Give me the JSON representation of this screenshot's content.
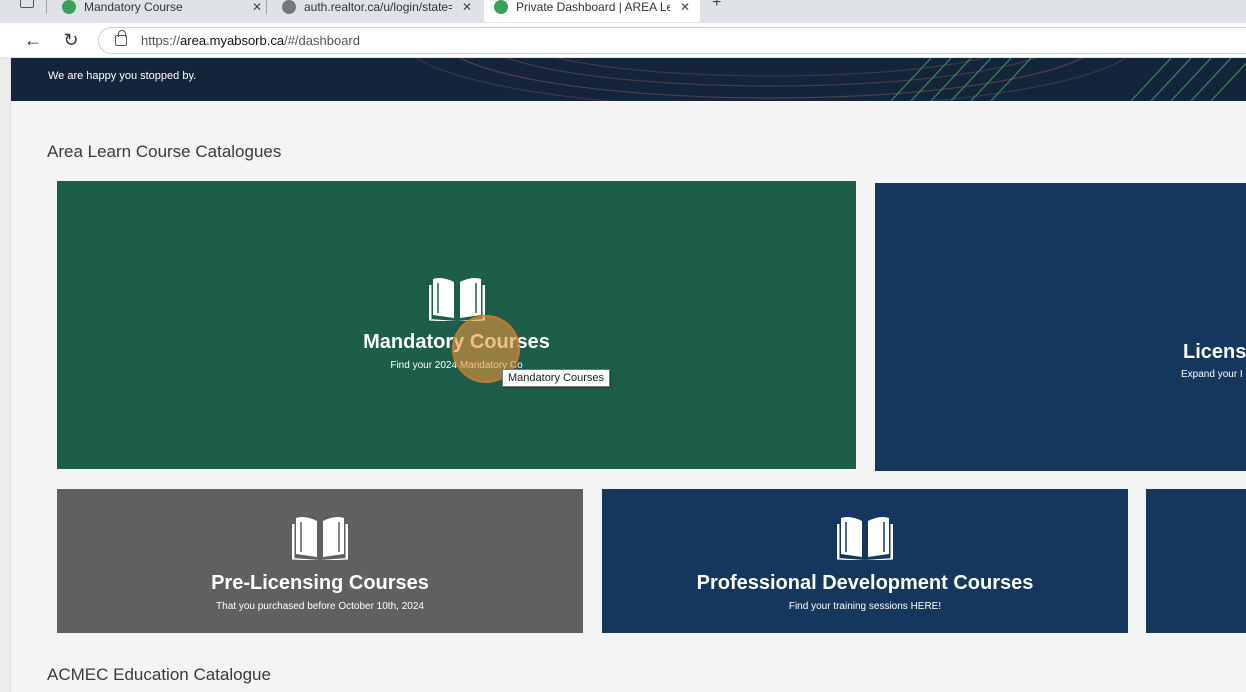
{
  "browser": {
    "tabs": [
      {
        "title": "Mandatory Course",
        "favicon_color": "#3aa05a"
      },
      {
        "title": "auth.realtor.ca/u/login/state=hKFo",
        "favicon_color": "#777777"
      },
      {
        "title": "Private Dashboard | AREA Learn",
        "favicon_color": "#3aa05a"
      }
    ],
    "close_glyph": "✕",
    "new_tab_glyph": "+",
    "back_glyph": "←",
    "reload_glyph": "↻",
    "url": {
      "scheme": "https://",
      "host": "area.myabsorb.ca",
      "path": "/#/dashboard"
    }
  },
  "hero": {
    "subtitle": "We are happy you stopped by."
  },
  "catalogue": {
    "title": "Area Learn Course Catalogues",
    "tiles": [
      {
        "title": "Mandatory Courses",
        "subtitle": "Find your 2024 Mandatory Co",
        "color": "#1c5e4a",
        "icon": "open-book-icon"
      },
      {
        "title": "Licensi",
        "subtitle": "Expand your I",
        "color": "#15375d",
        "icon": "open-book-icon"
      },
      {
        "title": "Pre-Licensing Courses",
        "subtitle": "That you purchased before October 10th, 2024",
        "color": "#5f6161",
        "icon": "open-book-icon"
      },
      {
        "title": "Professional Development Courses",
        "subtitle": "Find your training sessions HERE!",
        "color": "#15375d",
        "icon": "open-book-icon"
      },
      {
        "title": "",
        "subtitle": "",
        "color": "#15375d",
        "icon": ""
      }
    ]
  },
  "tooltip": {
    "text": "Mandatory Courses"
  },
  "second_section": {
    "title": "ACMEC Education Catalogue"
  }
}
